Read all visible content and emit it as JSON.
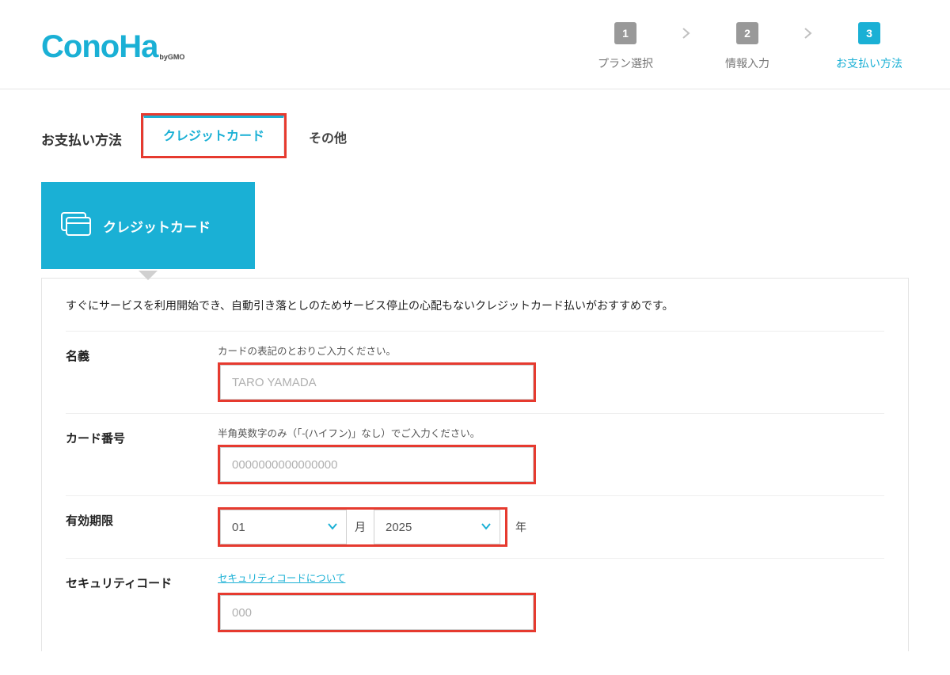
{
  "brand": {
    "name": "ConoHa",
    "sub": "byGMO"
  },
  "steps": [
    {
      "num": "1",
      "label": "プラン選択",
      "active": false
    },
    {
      "num": "2",
      "label": "情報入力",
      "active": false
    },
    {
      "num": "3",
      "label": "お支払い方法",
      "active": true
    }
  ],
  "tabs": {
    "heading": "お支払い方法",
    "items": [
      {
        "label": "クレジットカード",
        "selected": true
      },
      {
        "label": "その他",
        "selected": false
      }
    ]
  },
  "cardTile": {
    "label": "クレジットカード"
  },
  "form": {
    "info": "すぐにサービスを利用開始でき、自動引き落としのためサービス停止の心配もないクレジットカード払いがおすすめです。",
    "name": {
      "label": "名義",
      "hint": "カードの表記のとおりご入力ください。",
      "placeholder": "TARO YAMADA"
    },
    "number": {
      "label": "カード番号",
      "hint": "半角英数字のみ（「-(ハイフン)」なし）でご入力ください。",
      "placeholder": "0000000000000000"
    },
    "expiry": {
      "label": "有効期限",
      "month": "01",
      "year": "2025",
      "monthUnit": "月",
      "yearUnit": "年"
    },
    "security": {
      "label": "セキュリティコード",
      "link": "セキュリティコードについて",
      "placeholder": "000"
    }
  }
}
